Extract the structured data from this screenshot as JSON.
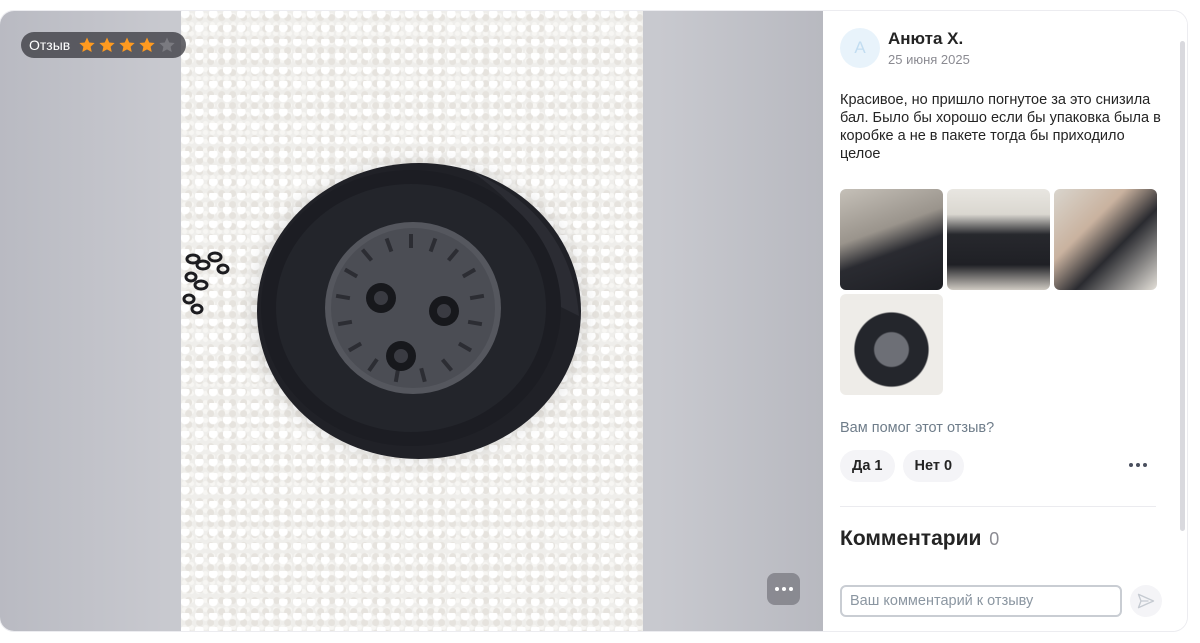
{
  "viewer": {
    "badge_label": "Отзыв",
    "rating": 4,
    "rating_max": 5,
    "star_color": "#ff9a1f"
  },
  "review": {
    "avatar_letter": "А",
    "author": "Анюта Х.",
    "date": "25 июня 2025",
    "text": "Красивое, но пришло погнутое за это снизила бал. Было бы хорошо если бы упаковка была в коробке а не в пакете тогда бы приходило целое",
    "helpful_question": "Вам помог этот отзыв?",
    "yes_label": "Да 1",
    "no_label": "Нет 0"
  },
  "comments": {
    "title": "Комментарии",
    "count": "0",
    "input_placeholder": "Ваш комментарий к отзыву"
  }
}
